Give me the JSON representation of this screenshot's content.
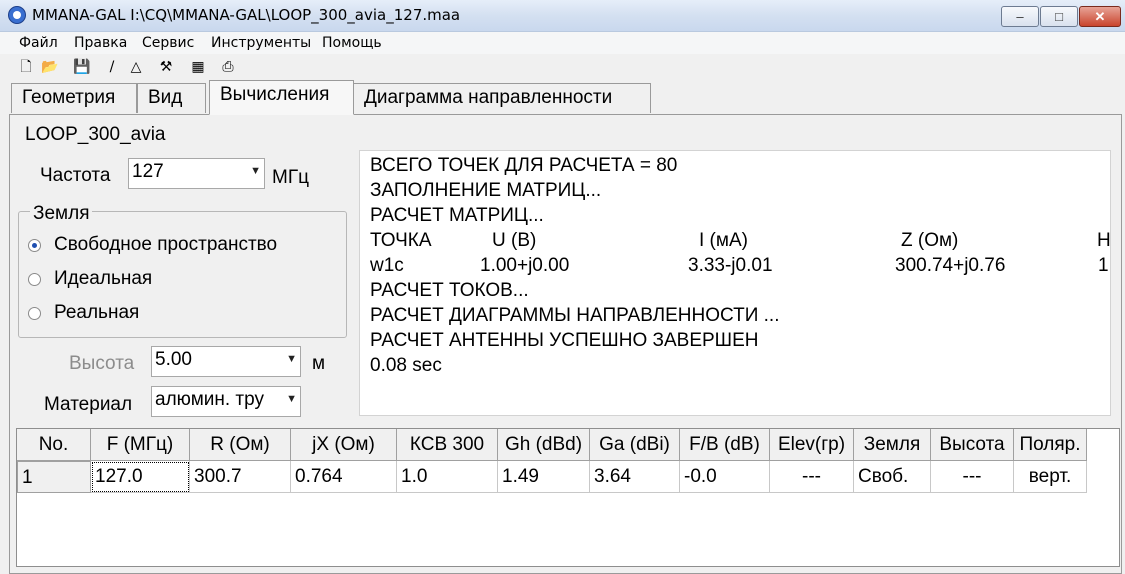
{
  "window": {
    "title": "MMANA-GAL I:\\CQ\\MMANA-GAL\\LOOP_300_avia_127.maa",
    "minimize_label": "–",
    "maximize_label": "□",
    "close_label": "✕"
  },
  "menu": [
    "Файл",
    "Правка",
    "Сервис",
    "Инструменты",
    "Помощь"
  ],
  "toolbar": {
    "new_glyph": "🗋",
    "open_glyph": "📂",
    "save_glyph": "💾",
    "line_glyph": "/",
    "triangle_glyph": "△",
    "tools_glyph": "⚒",
    "calc_glyph": "▦",
    "print_glyph": "⎙"
  },
  "tabs": [
    {
      "label": "Геометрия"
    },
    {
      "label": "Вид"
    },
    {
      "label": "Вычисления"
    },
    {
      "label": "Диаграмма направленности"
    }
  ],
  "active_tab": "Вычисления",
  "calc": {
    "antenna_name": "LOOP_300_avia",
    "freq_label": "Частота",
    "freq_value": "127",
    "freq_unit": "МГц",
    "ground": {
      "legend": "Земля",
      "options": [
        "Свободное пространство",
        "Идеальная",
        "Реальная"
      ],
      "selected": "Свободное пространство"
    },
    "height_label": "Высота",
    "height_value": "5.00",
    "height_unit": "м",
    "material_label": "Материал",
    "material_value": "алюмин. тру"
  },
  "output": {
    "lines": [
      "ВСЕГО ТОЧЕК ДЛЯ РАСЧЕТА = 80",
      "ЗАПОЛНЕНИЕ МАТРИЦ...",
      "РАСЧЕТ МАТРИЦ..."
    ],
    "table_header": [
      "ТОЧКА",
      "U (В)",
      "I (мА)",
      "Z (Ом)",
      "Н"
    ],
    "table_row": [
      "w1c",
      "1.00+j0.00",
      "3.33-j0.01",
      "300.74+j0.76",
      "1"
    ],
    "lines_after": [
      "РАСЧЕТ ТОКОВ...",
      "РАСЧЕТ ДИАГРАММЫ НАПРАВЛЕННОСТИ ...",
      "РАСЧЕТ АНТЕННЫ УСПЕШНО ЗАВЕРШЕН",
      "0.08 sec"
    ]
  },
  "results": {
    "headers": [
      "No.",
      "F (МГц)",
      "R (Ом)",
      "jX (Ом)",
      "КСВ 300",
      "Gh (dBd)",
      "Ga (dBi)",
      "F/B (dB)",
      "Elev(гр)",
      "Земля",
      "Высота",
      "Поляр."
    ],
    "rows": [
      [
        "1",
        "127.0",
        "300.7",
        "0.764",
        "1.0",
        "1.49",
        "3.64",
        "-0.0",
        "---",
        "Своб.",
        "---",
        "верт."
      ]
    ]
  }
}
